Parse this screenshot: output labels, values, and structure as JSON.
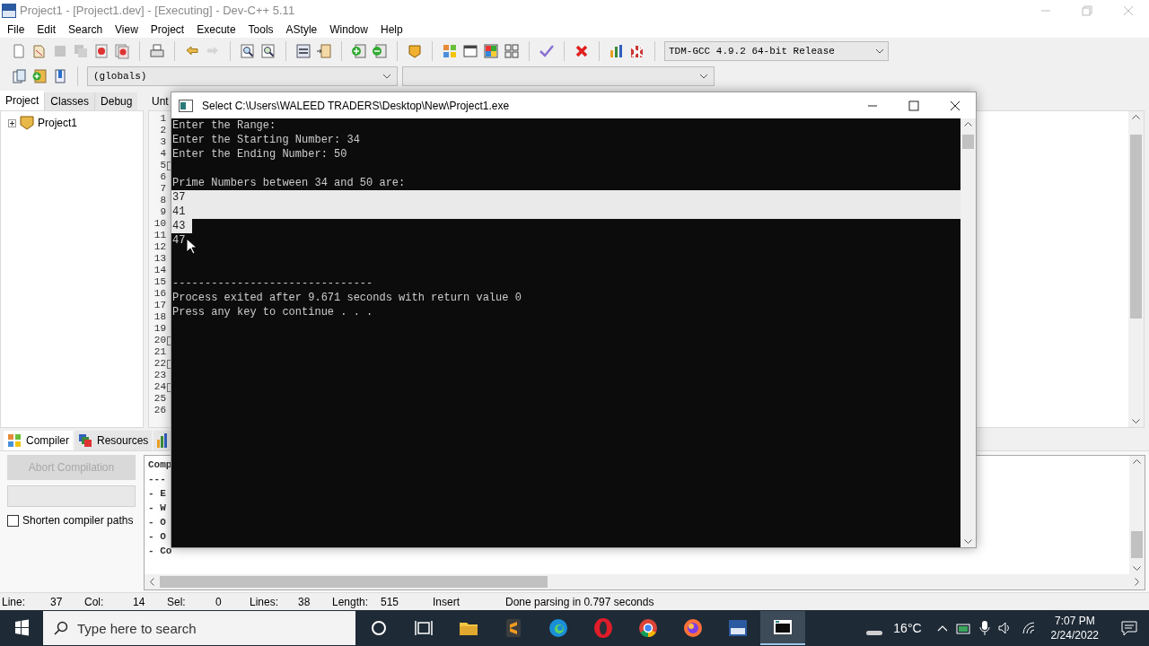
{
  "window": {
    "title": "Project1 - [Project1.dev] - [Executing] - Dev-C++ 5.11"
  },
  "menu": [
    "File",
    "Edit",
    "Search",
    "View",
    "Project",
    "Execute",
    "Tools",
    "AStyle",
    "Window",
    "Help"
  ],
  "toolbar": [
    {
      "kind": "new",
      "disabled": false
    },
    {
      "kind": "open",
      "disabled": false
    },
    {
      "kind": "save",
      "disabled": true
    },
    {
      "kind": "save-all",
      "disabled": true
    },
    {
      "kind": "close",
      "disabled": false
    },
    {
      "kind": "close-all",
      "disabled": false
    },
    {
      "kind": "separator"
    },
    {
      "kind": "print",
      "disabled": false
    },
    {
      "kind": "separator"
    },
    {
      "kind": "undo",
      "disabled": false
    },
    {
      "kind": "redo",
      "disabled": true
    },
    {
      "kind": "separator"
    },
    {
      "kind": "find",
      "disabled": false
    },
    {
      "kind": "replace",
      "disabled": false
    },
    {
      "kind": "separator"
    },
    {
      "kind": "indent",
      "disabled": false
    },
    {
      "kind": "unindent",
      "disabled": false
    },
    {
      "kind": "separator"
    },
    {
      "kind": "add",
      "disabled": false
    },
    {
      "kind": "remove",
      "disabled": false
    },
    {
      "kind": "separator"
    },
    {
      "kind": "class",
      "disabled": false
    },
    {
      "kind": "separator"
    },
    {
      "kind": "compile",
      "disabled": false
    },
    {
      "kind": "run",
      "disabled": false
    },
    {
      "kind": "compile-run",
      "disabled": false
    },
    {
      "kind": "rebuild",
      "disabled": false
    },
    {
      "kind": "separator"
    },
    {
      "kind": "check",
      "disabled": false
    },
    {
      "kind": "separator"
    },
    {
      "kind": "stop",
      "disabled": false
    },
    {
      "kind": "separator"
    },
    {
      "kind": "chart",
      "disabled": false
    },
    {
      "kind": "chart-delete",
      "disabled": false
    },
    {
      "kind": "separator"
    }
  ],
  "compiler_select": {
    "value": "TDM-GCC 4.9.2 64-bit Release"
  },
  "toolbar_2": [
    {
      "kind": "insert"
    },
    {
      "kind": "goto"
    },
    {
      "kind": "bookmark"
    }
  ],
  "scope_select": {
    "value": "(globals)"
  },
  "left_tabs": [
    {
      "label": "Project",
      "selected": true
    },
    {
      "label": "Classes",
      "selected": false
    },
    {
      "label": "Debug",
      "selected": false
    }
  ],
  "project_tree": [
    {
      "label": "Project1",
      "expanded": false
    }
  ],
  "editor_tab": {
    "label": "Unt"
  },
  "gutter": [
    {
      "number": "1",
      "fold": false
    },
    {
      "number": "2",
      "fold": false
    },
    {
      "number": "3",
      "fold": false
    },
    {
      "number": "4",
      "fold": false
    },
    {
      "number": "5",
      "fold": true
    },
    {
      "number": "6",
      "fold": false
    },
    {
      "number": "7",
      "fold": false
    },
    {
      "number": "8",
      "fold": false
    },
    {
      "number": "9",
      "fold": false
    },
    {
      "number": "10",
      "fold": false
    },
    {
      "number": "11",
      "fold": false
    },
    {
      "number": "12",
      "fold": false
    },
    {
      "number": "13",
      "fold": false
    },
    {
      "number": "14",
      "fold": false
    },
    {
      "number": "15",
      "fold": false
    },
    {
      "number": "16",
      "fold": false
    },
    {
      "number": "17",
      "fold": false
    },
    {
      "number": "18",
      "fold": false
    },
    {
      "number": "19",
      "fold": false
    },
    {
      "number": "20",
      "fold": true
    },
    {
      "number": "21",
      "fold": false
    },
    {
      "number": "22",
      "fold": true
    },
    {
      "number": "23",
      "fold": false
    },
    {
      "number": "24",
      "fold": true
    },
    {
      "number": "25",
      "fold": false
    },
    {
      "number": "26",
      "fold": false
    }
  ],
  "bottom_tabs": [
    {
      "kind": "compiler",
      "label": "Compiler",
      "selected": true
    },
    {
      "kind": "resources",
      "label": "Resources",
      "selected": false
    },
    {
      "kind": "chart",
      "selected": false
    }
  ],
  "compiler_panel": {
    "abort_button": {
      "label": "Abort Compilation",
      "disabled": true
    },
    "shorten_paths": {
      "label": "Shorten compiler paths",
      "checked": false
    },
    "output": [
      "Comp",
      "---",
      "- E",
      "- W",
      "- O",
      "- O",
      "- Co"
    ]
  },
  "status_bar": {
    "fields": [
      {
        "label": "Line:",
        "value": "37"
      },
      {
        "label": "Col:",
        "value": "14"
      },
      {
        "label": "Sel:",
        "value": "0"
      },
      {
        "label": "Lines:",
        "value": "38"
      },
      {
        "label": "Length:",
        "value": "515"
      }
    ],
    "mode": "Insert",
    "message": "Done parsing in 0.797 seconds"
  },
  "console": {
    "title": "Select C:\\Users\\WALEED TRADERS\\Desktop\\New\\Project1.exe",
    "lines": [
      {
        "kind": "text",
        "text": "Enter the Range:",
        "selected": false,
        "row_selected": false
      },
      {
        "kind": "text",
        "text": "Enter the Starting Number: 34",
        "selected": false,
        "row_selected": false
      },
      {
        "kind": "text",
        "text": "Enter the Ending Number: 50",
        "selected": false,
        "row_selected": false
      },
      {
        "kind": "blank"
      },
      {
        "kind": "text",
        "text": "Prime Numbers between 34 and 50 are:",
        "selected": false,
        "row_selected": false
      },
      {
        "kind": "text",
        "text": "37",
        "selected": true,
        "row_selected": true
      },
      {
        "kind": "text",
        "text": "41",
        "selected": true,
        "row_selected": true
      },
      {
        "kind": "text",
        "text": "43",
        "selected": true,
        "row_selected": false
      },
      {
        "kind": "text",
        "text": "47",
        "selected": false,
        "row_selected": false
      },
      {
        "kind": "blank"
      },
      {
        "kind": "blank"
      },
      {
        "kind": "text",
        "text": "-------------------------------",
        "selected": false,
        "row_selected": false
      },
      {
        "kind": "text",
        "text": "Process exited after 9.671 seconds with return value 0",
        "selected": false,
        "row_selected": false
      },
      {
        "kind": "text",
        "text": "Press any key to continue . . .",
        "selected": false,
        "row_selected": false
      }
    ]
  },
  "taskbar": {
    "search": {
      "placeholder": "Type here to search"
    },
    "apps": [
      {
        "kind": "cortana",
        "active": false
      },
      {
        "kind": "task-view",
        "active": false
      },
      {
        "kind": "folder",
        "active": false
      },
      {
        "kind": "sublime",
        "active": false
      },
      {
        "kind": "edge",
        "active": false
      },
      {
        "kind": "opera",
        "active": false
      },
      {
        "kind": "chrome",
        "active": false
      },
      {
        "kind": "firefox",
        "active": false
      },
      {
        "kind": "devcpp",
        "active": false
      },
      {
        "kind": "console",
        "active": true
      }
    ],
    "weather": "16°C",
    "time": "7:07 PM",
    "date": "2/24/2022"
  }
}
